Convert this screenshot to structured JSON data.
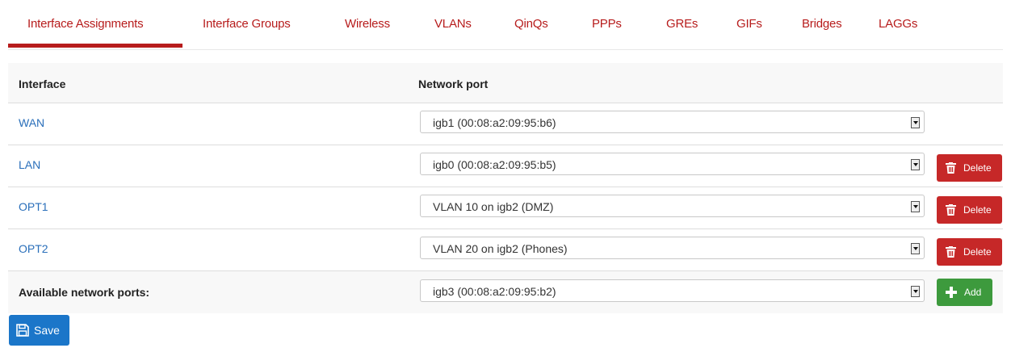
{
  "tabs": [
    {
      "label": "Interface Assignments",
      "active": true
    },
    {
      "label": "Interface Groups"
    },
    {
      "label": "Wireless"
    },
    {
      "label": "VLANs"
    },
    {
      "label": "QinQs"
    },
    {
      "label": "PPPs"
    },
    {
      "label": "GREs"
    },
    {
      "label": "GIFs"
    },
    {
      "label": "Bridges"
    },
    {
      "label": "LAGGs"
    }
  ],
  "table": {
    "headers": {
      "interface": "Interface",
      "network_port": "Network port"
    },
    "rows": [
      {
        "interface": "WAN",
        "port": "igb1 (00:08:a2:09:95:b6)"
      },
      {
        "interface": "LAN",
        "port": "igb0 (00:08:a2:09:95:b5)",
        "action": "Delete"
      },
      {
        "interface": "OPT1",
        "port": "VLAN 10 on igb2 (DMZ)",
        "action": "Delete"
      },
      {
        "interface": "OPT2",
        "port": "VLAN 20 on igb2 (Phones)",
        "action": "Delete"
      }
    ],
    "available": {
      "label": "Available network ports:",
      "port": "igb3 (00:08:a2:09:95:b2)",
      "action": "Add"
    }
  },
  "save_label": "Save",
  "colors": {
    "accent_red": "#b71c1c",
    "link_blue": "#2a6fba",
    "delete_red": "#c62828",
    "add_green": "#3d9a3d",
    "save_blue": "#1b76c9"
  },
  "icons": {
    "delete": "trash-icon",
    "add": "plus-icon",
    "save": "floppy-disk-icon"
  }
}
